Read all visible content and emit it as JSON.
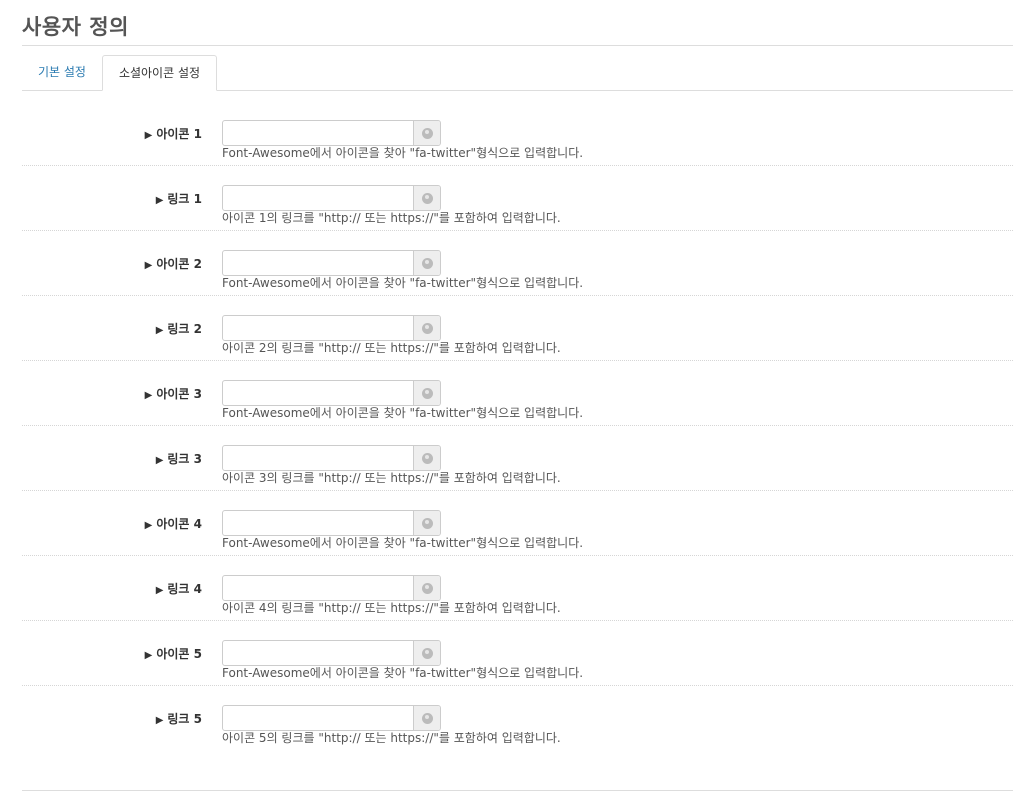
{
  "page": {
    "title": "사용자 정의"
  },
  "tabs": [
    {
      "label": "기본 설정",
      "active": false
    },
    {
      "label": "소셜아이콘 설정",
      "active": true
    }
  ],
  "fields": [
    {
      "label": "아이콘 1",
      "value": "",
      "help": "Font-Awesome에서 아이콘을 찾아 \"fa-twitter\"형식으로 입력합니다.",
      "addon_icon": "globe-icon"
    },
    {
      "label": "링크 1",
      "value": "",
      "help": "아이콘 1의 링크를 \"http:// 또는 https://\"를 포함하여 입력합니다.",
      "addon_icon": "globe-icon"
    },
    {
      "label": "아이콘 2",
      "value": "",
      "help": "Font-Awesome에서 아이콘을 찾아 \"fa-twitter\"형식으로 입력합니다.",
      "addon_icon": "globe-icon"
    },
    {
      "label": "링크 2",
      "value": "",
      "help": "아이콘 2의 링크를 \"http:// 또는 https://\"를 포함하여 입력합니다.",
      "addon_icon": "globe-icon"
    },
    {
      "label": "아이콘 3",
      "value": "",
      "help": "Font-Awesome에서 아이콘을 찾아 \"fa-twitter\"형식으로 입력합니다.",
      "addon_icon": "globe-icon"
    },
    {
      "label": "링크 3",
      "value": "",
      "help": "아이콘 3의 링크를 \"http:// 또는 https://\"를 포함하여 입력합니다.",
      "addon_icon": "globe-icon"
    },
    {
      "label": "아이콘 4",
      "value": "",
      "help": "Font-Awesome에서 아이콘을 찾아 \"fa-twitter\"형식으로 입력합니다.",
      "addon_icon": "globe-icon"
    },
    {
      "label": "링크 4",
      "value": "",
      "help": "아이콘 4의 링크를 \"http:// 또는 https://\"를 포함하여 입력합니다.",
      "addon_icon": "globe-icon"
    },
    {
      "label": "아이콘 5",
      "value": "",
      "help": "Font-Awesome에서 아이콘을 찾아 \"fa-twitter\"형식으로 입력합니다.",
      "addon_icon": "globe-icon"
    },
    {
      "label": "링크 5",
      "value": "",
      "help": "아이콘 5의 링크를 \"http:// 또는 https://\"를 포함하여 입력합니다.",
      "addon_icon": "globe-icon"
    }
  ],
  "colors": {
    "tab_link": "#2a7ab0",
    "border": "#dddddd",
    "addon_bg": "#eeeeee"
  }
}
